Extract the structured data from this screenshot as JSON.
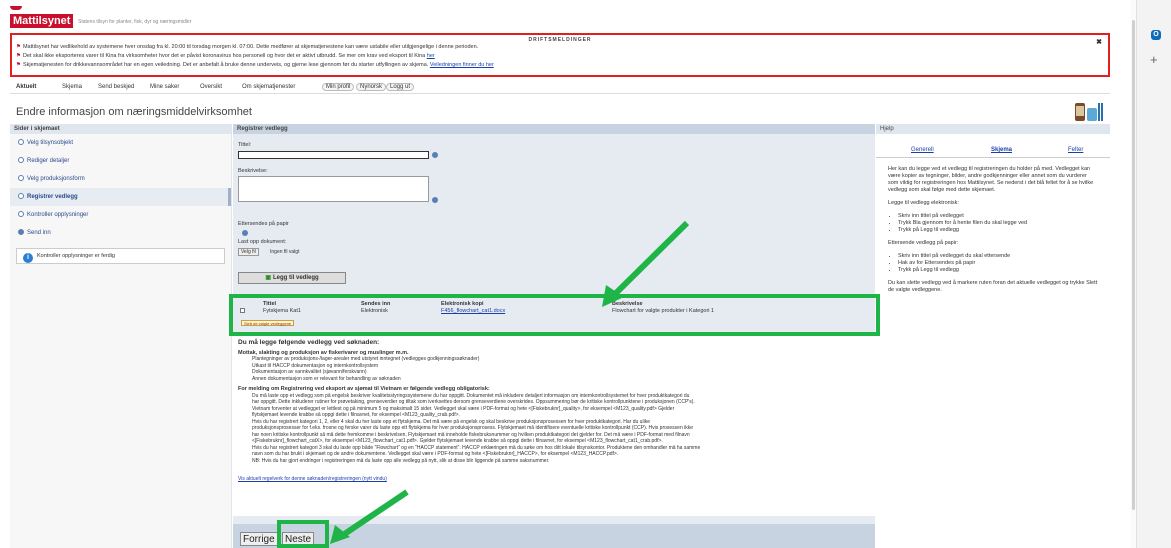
{
  "header": {
    "brand": "Mattilsynet",
    "tagline": "Statens tilsyn for planter, fisk, dyr og næringsmidler"
  },
  "driftsmeldinger": {
    "title": "DRIFTSMELDINGER",
    "close": "✖",
    "lines": [
      {
        "prefix": "Mattilsynet har vedlikehold av systemene hver onsdag fra kl. 20:00 til torsdag morgen kl. 07:00. Dette medfører at skjematjenestene kan være ustabile eller utilgjengelige i denne perioden.",
        "link": ""
      },
      {
        "prefix": "Det skal ikke eksporteres varer til Kina fra virksomheter hvor det er påvist koronavirus hos personell og hvor det er aktivt utbrudd. Se mer om krav ved eksport til Kina",
        "link": "her"
      },
      {
        "prefix": "Skjematjenesten for drikkevannsområdet har en egen veiledning. Det er anbefalt å bruke denne underveis, og gjerne lese gjennom før du starter utfyllingen av skjema.",
        "link": "Veiledningen finner du her"
      }
    ]
  },
  "nav": {
    "items": [
      "Aktuelt",
      "Skjema",
      "Send beskjed",
      "Mine saker",
      "Oversikt",
      "Om skjematjenester"
    ],
    "pills": [
      "Min profil",
      "Nynorsk",
      "Logg ut"
    ]
  },
  "page_title": "Endre informasjon om næringsmiddelvirksomhet",
  "sidebar": {
    "header": "Sider i skjemaet",
    "steps": [
      "Velg tilsynsobjekt",
      "Rediger detaljer",
      "Velg produksjonsform",
      "Registrer vedlegg",
      "Kontroller opplysninger",
      "Send inn"
    ],
    "status": "Kontroller opplysninger er ferdig"
  },
  "main": {
    "header": "Registrer vedlegg",
    "tittel_label": "Tittel:",
    "beskrivelse_label": "Beskrivelse:",
    "ettersendes_label": "Ettersendes på papir",
    "upload_label": "Last opp dokument:",
    "file_button": "Velg fil",
    "file_none": "Ingen fil valgt",
    "add_button": "Legg til vedlegg",
    "table": {
      "headers": [
        "Tittel",
        "Sendes inn",
        "Elektronisk kopi",
        "Beskrivelse"
      ],
      "rows": [
        {
          "tittel": "Fytskjema Kat1",
          "sendes": "Elektronisk",
          "kopi": "F456_flowchart_cat1.docx",
          "beskrivelse": "Flowchart for valgte produkter i Kategori 1"
        }
      ],
      "delete_button": "Slett de valgte vedleggene"
    },
    "req": {
      "title": "Du må legge følgende vedlegg ved søknaden:",
      "sub1": "Mottak, slakting og produksjon av fiskerivarer og muslinger m.m.",
      "list1": [
        "Plantegninger av produksjons-/lager-arealer med utstyret inntegnet (vedlegges godkjenningssøknader)",
        "Utkast til HACCP dokumentasjon og internkontrollsystem",
        "Dokumentasjon av vannkvalitet (sjøvann/ferskvann)",
        "Annen dokumentasjon som er relevant for behandling av søknaden"
      ],
      "sub2": "For melding om Registrering ved eksport av sjømat til Vietnam er følgende vedlegg obligatorisk:",
      "list2": [
        "Du må laste opp et vedlegg som på engelsk beskriver kvalitetsstyringssystemene du har oppgitt. Dokumentet må inkludere detaljert informasjon om internkontrollsystemet for hver produktkategori du",
        "har oppgitt. Dette inkluderer rutiner for prøvetaking, grenseverdier og tiltak som iverksettes dersom grenseverdiene overskrides. Oppsummering bør de kritiske kontrollpunktene i produksjonen (CCP's).",
        "Vietnam forventer at vedlegget er lettlest og på minimum 5 og maksimalt 15 sider. Vedlegget skal være i PDF-format og hete <[Fiskebruknr]_quality>, for eksempel <M123_quality.pdf> Gjelder",
        "flytskjemaet levende krabbe så oppgi dette i filnavnet, for eksempel <M123_quality_crab.pdf>.",
        "Hvis du har registrert kategori 1, 2, eller 4 skal du her laste opp et flytskjema. Det må være på engelsk og skal beskrive produksjonsprosessen for hver produktkategori. Har du ulike",
        "produksjonsprosesser for f.eks. frosne og ferske varer du laste opp ett flytskjema for hver produksjonsprosess. Flytskjemaet må identifisere eventuelle kritiske kontrollpunkt (CCP). Hvis prosessen ikke",
        "har noen kritiske kontrollpunkt så må dette fremkomme i beskrivelsen. Flytskjemaet må inneholde fiskebruksnummer og hvilken produktkategori det gjelder for. Det må være i PDF-format med filnavn",
        "<[Fiskebruknr]_flowchart_catX>, for eksempel <M123_flowchart_cat1.pdf>. Gjelder flytskjemaet levende krabbe så oppgi dette i filnavnet, for eksempel <M123_flowchart_cat1_crab.pdf>.",
        "Hvis du har registrert kategori 3 skal du laste opp både \"Flowchart\" og en \"HACCP statement\". HACCP erklæringen må du søke om hos ditt lokale tilsynskontor. Produktene den omhandler må ha samme",
        "navn som du har brukt i skjemaet og de andre dokumentene. Vedlegget skal være i PDF-format og hete <[Fiskebruknr]_HACCP>, for eksempel <M123_HACCP.pdf>.",
        "NB: Hvis du har gjort endringer i registreringen må du laste opp alle vedlegg på nytt, slik at disse blir liggende på samme saksnummer."
      ],
      "link": "Vis aktuelt regelverk for denne søknaden/registreringen (nytt vindu)"
    },
    "back_button": "Forrige",
    "next_button": "Neste"
  },
  "help": {
    "header": "Hjelp",
    "tabs": [
      "Generell",
      "Skjema",
      "Felter"
    ],
    "intro": "Her kan du legge ved et vedlegg til registreringen du holder på med. Vedlegget kan være kopier av tegninger, bilder, andre godkjenninger eller annet som du vurderer som viktig for registreringen hos Mattilsynet. Se nederst i det blå feltet for å se hvilke vedlegg som skal følge med dette skjemaet.",
    "electronic_title": "Legge til vedlegg elektronisk:",
    "electronic_list": [
      "Skriv inn tittel på vedlegget",
      "Trykk Bla gjennom for å hente filen du skal legge ved",
      "Trykk på Legg til vedlegg"
    ],
    "paper_title": "Ettersende vedlegg på papir:",
    "paper_list": [
      "Skriv inn tittel på vedlegget du skal ettersende",
      "Hak av for Ettersendes på papir",
      "Trykk på Legg til vedlegg"
    ],
    "delete_text": "Du kan slette vedlegg ved å markere ruten foran det aktuelle vedlegget og trykke Slett de valgte vedleggene."
  },
  "colors": {
    "brand": "#c8102e",
    "alert_border": "#e02020",
    "highlight": "#1fb447",
    "panel": "#e6ebf2"
  }
}
